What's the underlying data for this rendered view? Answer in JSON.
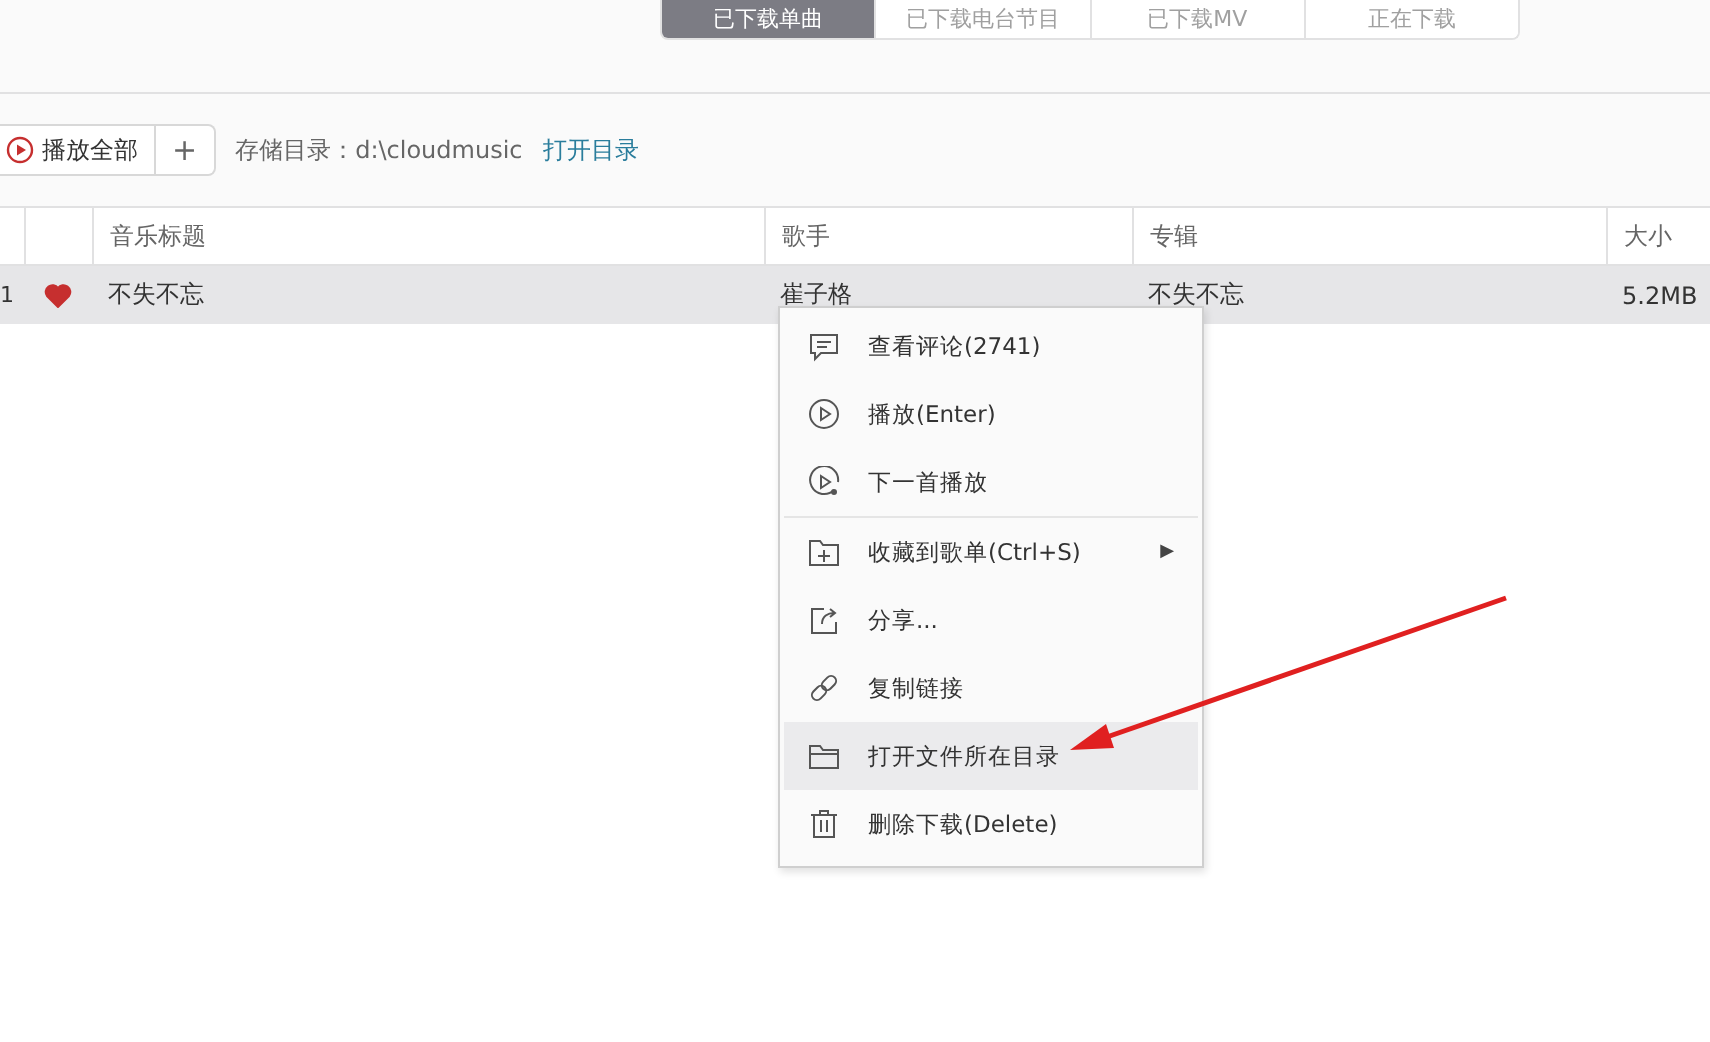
{
  "tabs": [
    {
      "label": "已下载单曲",
      "selected": true
    },
    {
      "label": "已下载电台节目",
      "selected": false
    },
    {
      "label": "已下载MV",
      "selected": false
    },
    {
      "label": "正在下载",
      "selected": false
    }
  ],
  "toolbar": {
    "play_all": "播放全部",
    "add": "+",
    "storage": "存储目录：d:\\cloudmusic",
    "open_dir": "打开目录"
  },
  "table": {
    "columns": [
      "音乐标题",
      "歌手",
      "专辑",
      "大小"
    ],
    "rows": [
      {
        "index": "1",
        "liked": true,
        "title": "不失不忘",
        "artist": "崔子格",
        "album": "不失不忘",
        "size": "5.2MB",
        "selected": true
      }
    ]
  },
  "context_menu": {
    "items": [
      {
        "kind": "item",
        "label": "查看评论(2741)",
        "highlighted": false,
        "separator_after": false
      },
      {
        "kind": "item",
        "label": "播放(Enter)",
        "highlighted": false,
        "separator_after": false
      },
      {
        "kind": "item",
        "label": "下一首播放",
        "highlighted": false,
        "separator_after": true
      },
      {
        "kind": "submenu",
        "label": "收藏到歌单(Ctrl+S)",
        "arrow": "▶",
        "highlighted": false,
        "separator_after": false
      },
      {
        "kind": "item",
        "label": "分享...",
        "highlighted": false,
        "separator_after": false
      },
      {
        "kind": "item",
        "label": "复制链接",
        "highlighted": false,
        "separator_after": false
      },
      {
        "kind": "item",
        "label": "打开文件所在目录",
        "highlighted": true,
        "separator_after": false
      },
      {
        "kind": "item",
        "label": "删除下载(Delete)",
        "highlighted": false,
        "separator_after": false
      }
    ]
  }
}
